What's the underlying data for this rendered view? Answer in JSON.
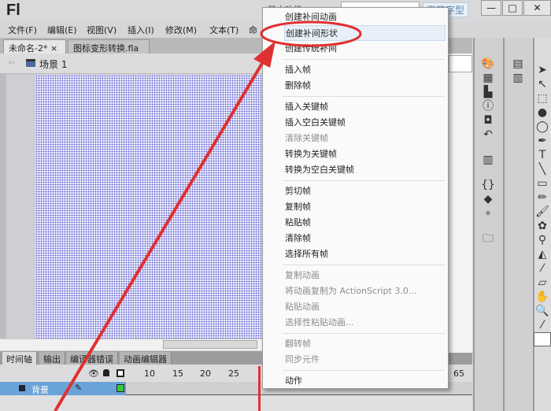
{
  "app": {
    "logo": "Fl",
    "workspace": "基本功能",
    "watermark": "天笔字型",
    "min": "—",
    "max": "□",
    "close": "✕"
  },
  "menubar": [
    "文件(F)",
    "编辑(E)",
    "视图(V)",
    "插入(I)",
    "修改(M)",
    "文本(T)",
    "命"
  ],
  "doc_tabs": [
    {
      "label": "未命名-2*",
      "close": "×"
    },
    {
      "label": "图标变形转换.fla",
      "close": "×"
    }
  ],
  "scene": {
    "back": "⇦",
    "label": "场景 1"
  },
  "timeline": {
    "tabs": [
      "时间轴",
      "输出",
      "编译器错误",
      "动画编辑器"
    ],
    "ticks": [
      "10",
      "15",
      "20",
      "25",
      "65"
    ],
    "layer": "背景"
  },
  "context_menu": {
    "groups": [
      [
        {
          "label": "创建补间动画",
          "enabled": true
        },
        {
          "label": "创建补间形状",
          "enabled": true,
          "highlighted": true
        },
        {
          "label": "创建传统补间",
          "enabled": true
        }
      ],
      [
        {
          "label": "插入帧",
          "enabled": true
        },
        {
          "label": "删除帧",
          "enabled": true
        }
      ],
      [
        {
          "label": "插入关键帧",
          "enabled": true
        },
        {
          "label": "插入空白关键帧",
          "enabled": true
        },
        {
          "label": "清除关键帧",
          "enabled": false
        },
        {
          "label": "转换为关键帧",
          "enabled": true
        },
        {
          "label": "转换为空白关键帧",
          "enabled": true
        }
      ],
      [
        {
          "label": "剪切帧",
          "enabled": true
        },
        {
          "label": "复制帧",
          "enabled": true
        },
        {
          "label": "粘贴帧",
          "enabled": true
        },
        {
          "label": "清除帧",
          "enabled": true
        },
        {
          "label": "选择所有帧",
          "enabled": true
        }
      ],
      [
        {
          "label": "复制动画",
          "enabled": false
        },
        {
          "label": "将动画复制为 ActionScript 3.0...",
          "enabled": false
        },
        {
          "label": "粘贴动画",
          "enabled": false
        },
        {
          "label": "选择性粘贴动画...",
          "enabled": false
        }
      ],
      [
        {
          "label": "翻转帧",
          "enabled": false
        },
        {
          "label": "同步元件",
          "enabled": false
        }
      ],
      [
        {
          "label": "动作",
          "enabled": true
        }
      ]
    ]
  },
  "annotation_color": "#e03030"
}
